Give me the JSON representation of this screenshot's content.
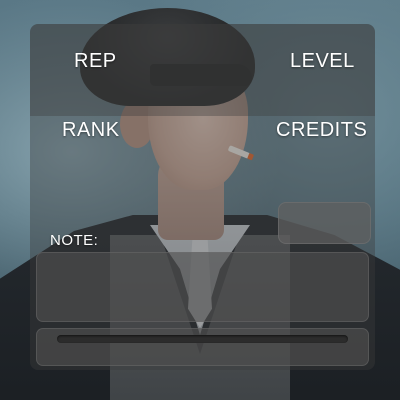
{
  "stats": {
    "rep_label": "REP",
    "level_label": "LEVEL",
    "rank_label": "RANK",
    "credits_label": "CREDITS"
  },
  "note": {
    "label": "NOTE:",
    "value": ""
  },
  "progress": {
    "value": 0
  },
  "colors": {
    "panel": "#3a3a3a",
    "text": "#ffffff"
  }
}
